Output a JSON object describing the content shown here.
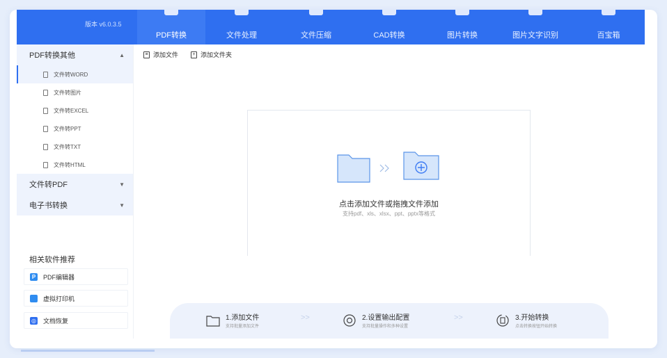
{
  "window": {
    "version": "版本 v6.0.3.5"
  },
  "tabs": [
    {
      "label": "PDF转换",
      "active": true
    },
    {
      "label": "文件处理",
      "active": false
    },
    {
      "label": "文件压缩",
      "active": false
    },
    {
      "label": "CAD转换",
      "active": false
    },
    {
      "label": "图片转换",
      "active": false
    },
    {
      "label": "图片文字识别",
      "active": false
    },
    {
      "label": "百宝箱",
      "active": false
    }
  ],
  "sidebar": {
    "groups": [
      {
        "label": "PDF转换其他",
        "expanded": true
      },
      {
        "label": "文件转PDF",
        "expanded": false
      },
      {
        "label": "电子书转换",
        "expanded": false
      }
    ],
    "items": [
      {
        "label": "文件转WORD",
        "active": true
      },
      {
        "label": "文件转图片",
        "active": false
      },
      {
        "label": "文件转EXCEL",
        "active": false
      },
      {
        "label": "文件转PPT",
        "active": false
      },
      {
        "label": "文件转TXT",
        "active": false
      },
      {
        "label": "文件转HTML",
        "active": false
      }
    ],
    "recommend_title": "相关软件推荐",
    "recommend": [
      {
        "label": "PDF编辑器",
        "icon": "pdf-editor-icon",
        "color": "#2f8cf0"
      },
      {
        "label": "虚拟打印机",
        "icon": "printer-icon",
        "color": "#2f8cf0"
      },
      {
        "label": "文档恢复",
        "icon": "recover-icon",
        "color": "#2f6ff0"
      }
    ]
  },
  "toolbar": {
    "add_file": "添加文件",
    "add_folder": "添加文件夹"
  },
  "dropzone": {
    "main": "点击添加文件或拖拽文件添加",
    "hint": "支持pdf、xls、xlsx、ppt、pptx等格式"
  },
  "steps": [
    {
      "title": "1.添加文件",
      "desc": "支持批量添加文件"
    },
    {
      "title": "2.设置输出配置",
      "desc": "支持批量操作和多种设置"
    },
    {
      "title": "3.开始转换",
      "desc": "点击转换按钮开始转换"
    }
  ],
  "colors": {
    "accent": "#2f6ff0",
    "sidebar_highlight": "#eef3fd"
  }
}
